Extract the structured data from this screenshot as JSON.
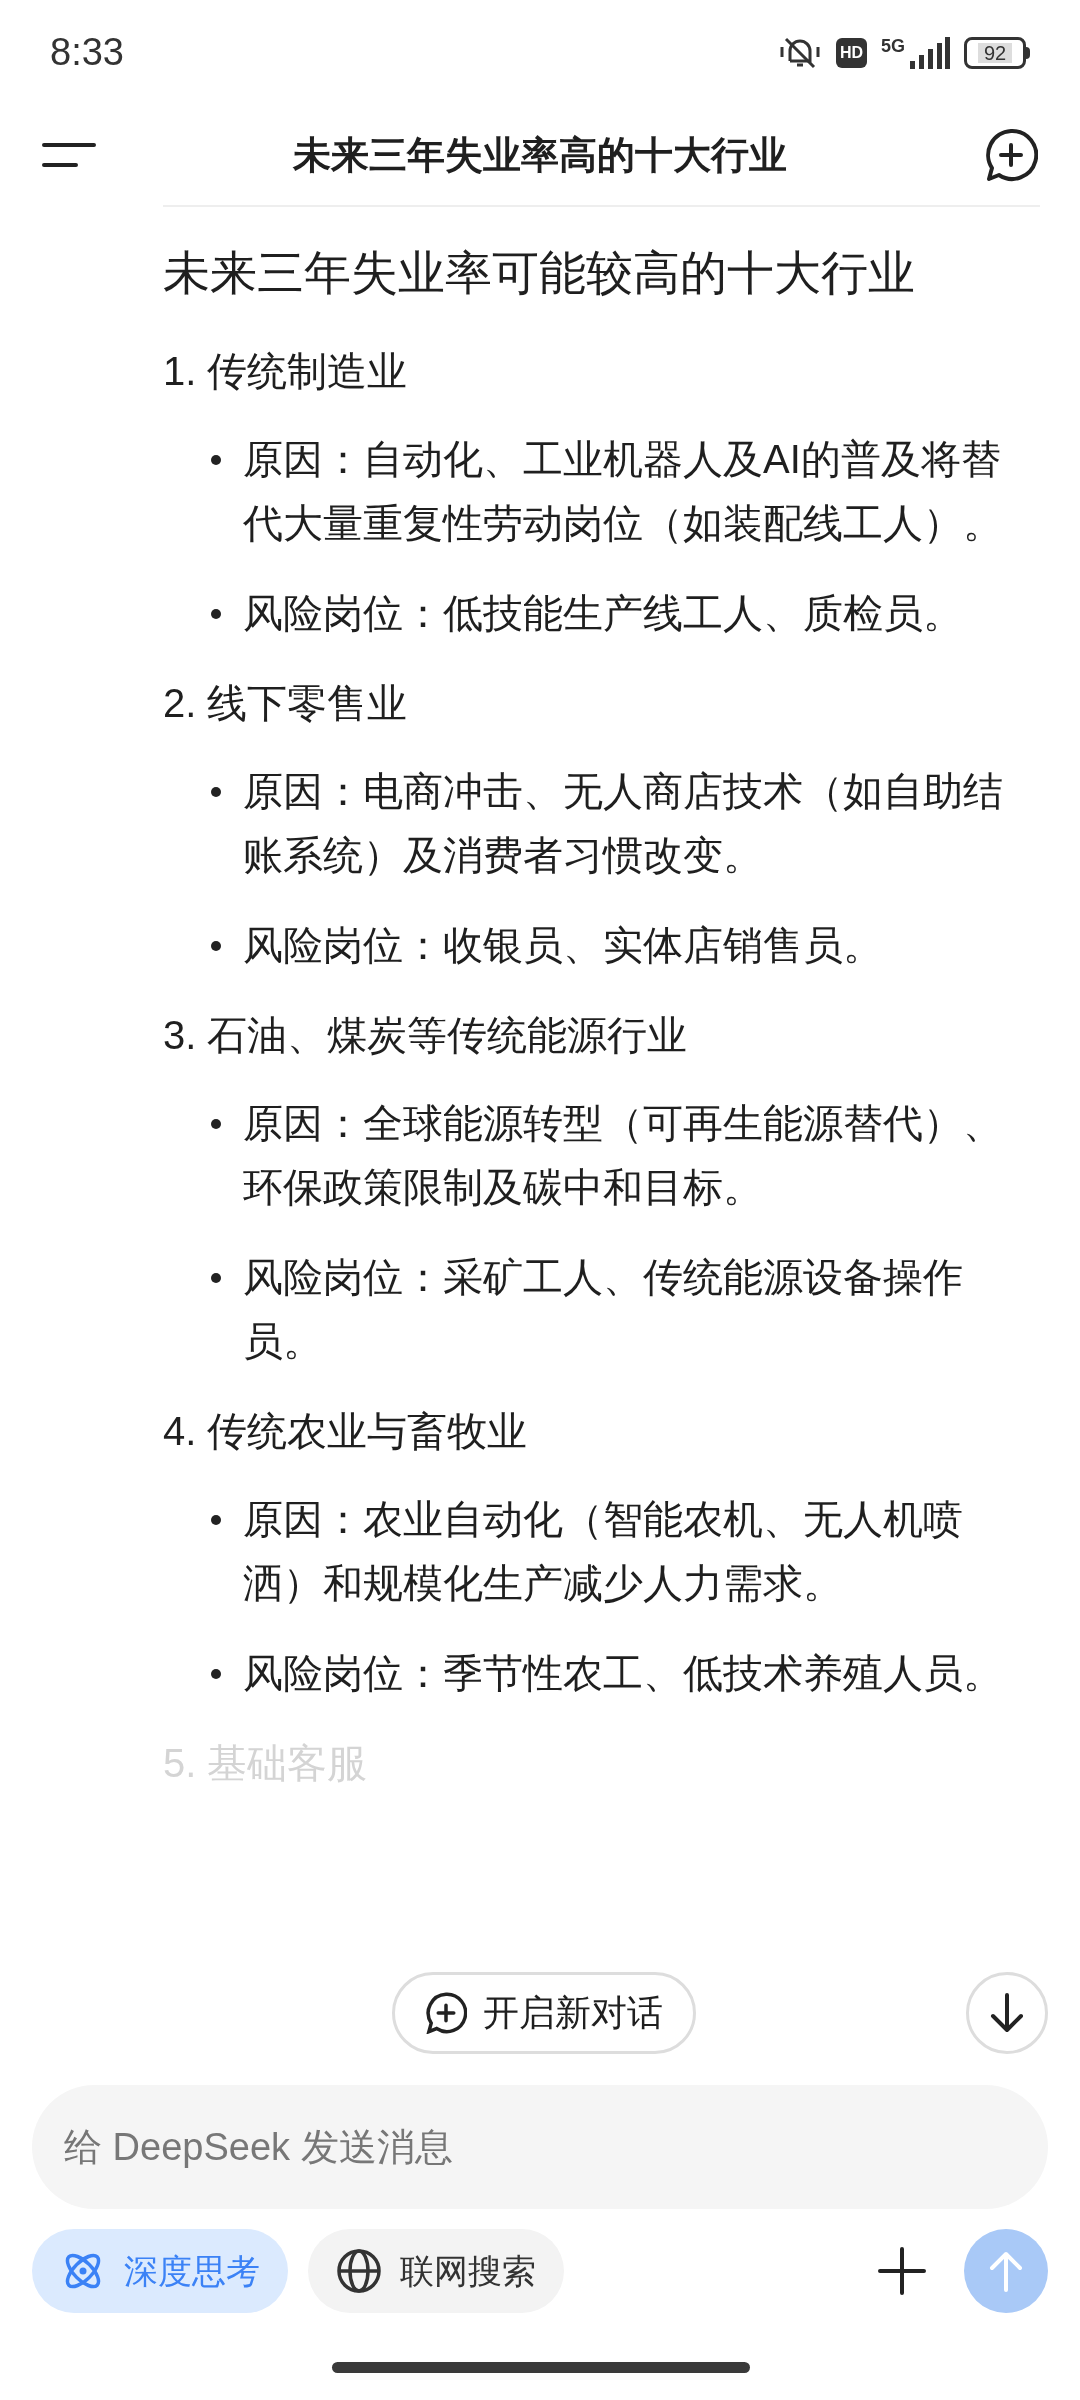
{
  "status_bar": {
    "time": "8:33",
    "hd": "HD",
    "network": "5G",
    "battery": "92"
  },
  "header": {
    "title": "未来三年失业率高的十大行业"
  },
  "article": {
    "heading": "未来三年失业率可能较高的十大行业",
    "sections": [
      {
        "number": "1.",
        "title": "传统制造业",
        "faded": false,
        "bullets": [
          "原因：自动化、工业机器人及AI的普及将替代大量重复性劳动岗位（如装配线工人）。",
          "风险岗位：低技能生产线工人、质检员。"
        ]
      },
      {
        "number": "2.",
        "title": "线下零售业",
        "faded": false,
        "bullets": [
          "原因：电商冲击、无人商店技术（如自助结账系统）及消费者习惯改变。",
          "风险岗位：收银员、实体店销售员。"
        ]
      },
      {
        "number": "3.",
        "title": "石油、煤炭等传统能源行业",
        "faded": false,
        "bullets": [
          "原因：全球能源转型（可再生能源替代）、环保政策限制及碳中和目标。",
          "风险岗位：采矿工人、传统能源设备操作员。"
        ]
      },
      {
        "number": "4.",
        "title": "传统农业与畜牧业",
        "faded": false,
        "bullets": [
          "原因：农业自动化（智能农机、无人机喷洒）和规模化生产减少人力需求。",
          "风险岗位：季节性农工、低技术养殖人员。"
        ]
      },
      {
        "number": "5.",
        "title": "基础客服",
        "faded": true
      }
    ]
  },
  "new_chat_button": "开启新对话",
  "composer": {
    "placeholder": "给 DeepSeek 发送消息",
    "chips": [
      {
        "kind": "think",
        "label": "深度思考",
        "selected": true
      },
      {
        "kind": "web",
        "label": "联网搜索",
        "selected": false
      }
    ]
  }
}
